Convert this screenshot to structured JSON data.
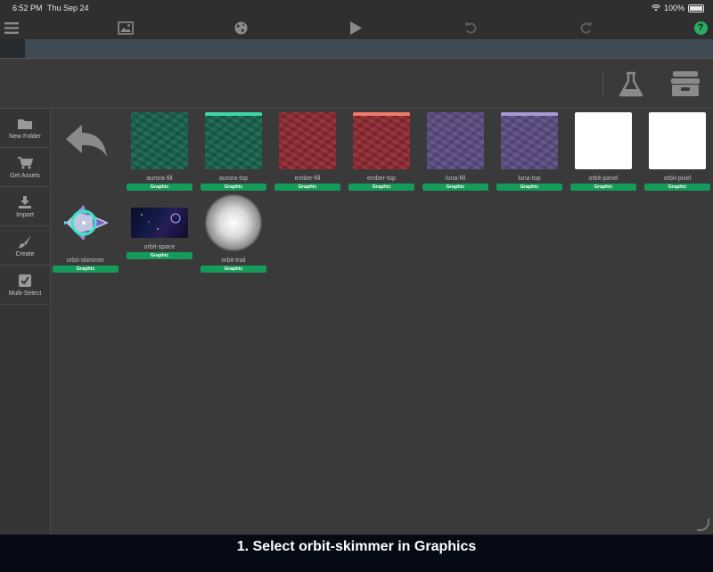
{
  "status_bar": {
    "time": "6:52 PM",
    "date": "Thu Sep 24",
    "battery": "100%"
  },
  "toolbar": {
    "icons": [
      "menu-icon",
      "image-icon",
      "globe-icon",
      "play-icon",
      "undo-icon",
      "redo-icon",
      "help-icon"
    ],
    "help_label": "?"
  },
  "sidebar": {
    "items": [
      {
        "label": "New Folder",
        "icon": "folder-icon"
      },
      {
        "label": "Get Assets",
        "icon": "cart-icon"
      },
      {
        "label": "Import",
        "icon": "download-icon"
      },
      {
        "label": "Create",
        "icon": "brush-icon"
      },
      {
        "label": "Multi-Select",
        "icon": "checkbox-icon"
      }
    ]
  },
  "assets": [
    {
      "name": "aurora-fill",
      "type": "Graphic"
    },
    {
      "name": "aurora-top",
      "type": "Graphic"
    },
    {
      "name": "ember-fill",
      "type": "Graphic"
    },
    {
      "name": "ember-top",
      "type": "Graphic"
    },
    {
      "name": "luna-fill",
      "type": "Graphic"
    },
    {
      "name": "luna-top",
      "type": "Graphic"
    },
    {
      "name": "orbit-panel",
      "type": "Graphic"
    },
    {
      "name": "orbit-pixel",
      "type": "Graphic"
    },
    {
      "name": "orbit-skimmer",
      "type": "Graphic"
    },
    {
      "name": "orbit-space",
      "type": "Graphic"
    },
    {
      "name": "orbit-trail",
      "type": "Graphic"
    }
  ],
  "caption": "1. Select orbit-skimmer in Graphics",
  "colors": {
    "accent_green": "#159b5a",
    "help_green": "#27ae60",
    "highlight_ring": "#3fe0c8"
  }
}
